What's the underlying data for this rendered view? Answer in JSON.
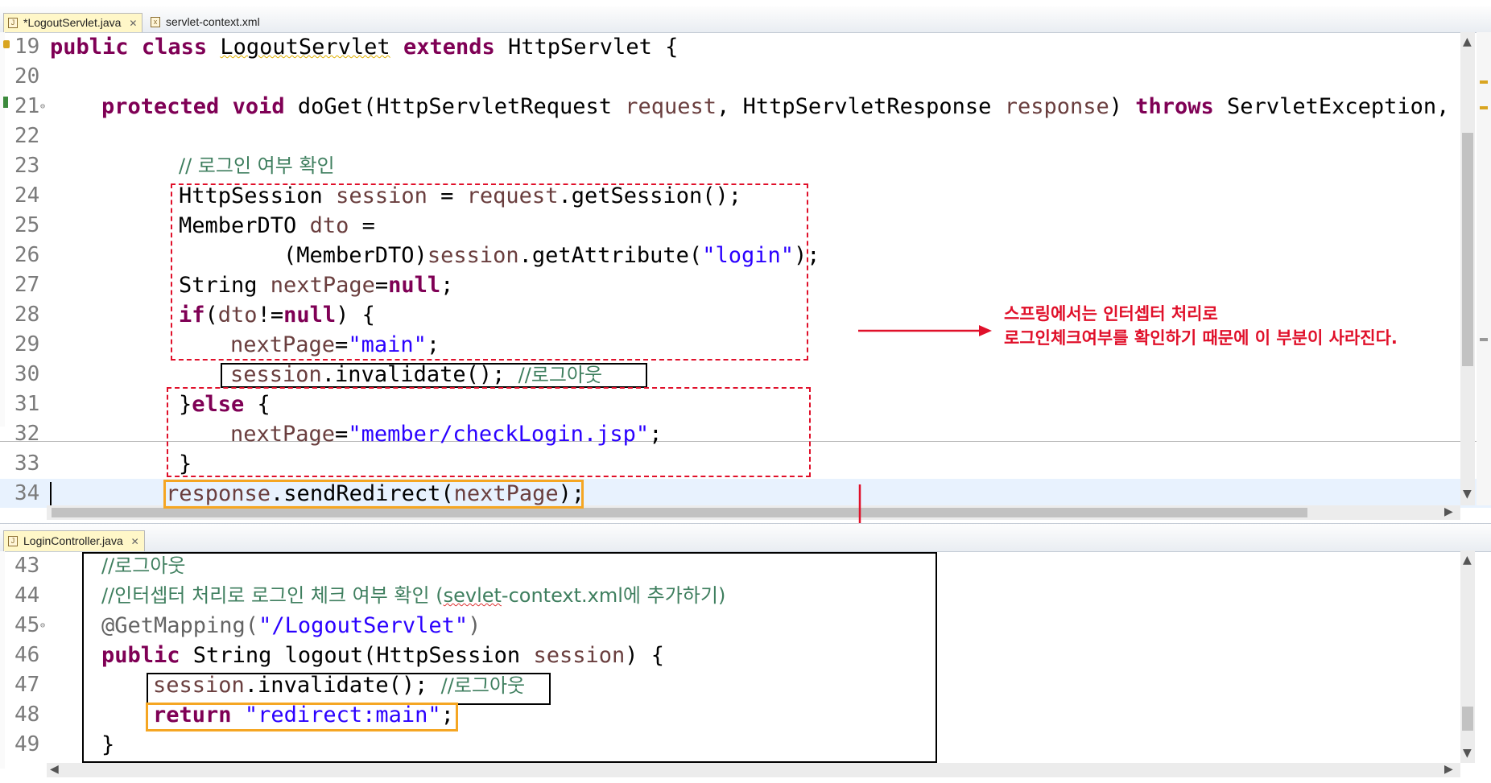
{
  "top_editor": {
    "tabs": [
      {
        "label": "*LogoutServlet.java",
        "close": "✕"
      },
      {
        "label": "servlet-context.xml"
      }
    ],
    "lines": {
      "l19": {
        "n": "19",
        "kw1": "public",
        "kw2": "class",
        "name": "LogoutServlet",
        "kw3": "extends",
        "rest": "HttpServlet {"
      },
      "l20": {
        "n": "20"
      },
      "l21": {
        "n": "21",
        "kw1": "protected",
        "kw2": "void",
        "t1": "doGet(HttpServletRequest ",
        "v1": "request",
        "t2": ", HttpServletResponse ",
        "v2": "response",
        "t3": ") ",
        "kw3": "throws",
        "t4": " ServletException, IO"
      },
      "l22": {
        "n": "22"
      },
      "l23": {
        "n": "23",
        "comment": "// 로그인 여부 확인"
      },
      "l24": {
        "n": "24",
        "t1": "HttpSession ",
        "v1": "session",
        "t2": " = ",
        "v2": "request",
        "t3": ".getSession();"
      },
      "l25": {
        "n": "25",
        "t1": "MemberDTO ",
        "v1": "dto",
        "t2": " ="
      },
      "l26": {
        "n": "26",
        "t1": "(MemberDTO)",
        "v1": "session",
        "t2": ".getAttribute(",
        "s1": "\"login\"",
        "t3": ");"
      },
      "l27": {
        "n": "27",
        "t1": "String ",
        "v1": "nextPage",
        "t2": "=",
        "kw1": "null",
        "t3": ";"
      },
      "l28": {
        "n": "28",
        "kw1": "if",
        "t1": "(",
        "v1": "dto",
        "t2": "!=",
        "kw2": "null",
        "t3": ") {"
      },
      "l29": {
        "n": "29",
        "v1": "nextPage",
        "t1": "=",
        "s1": "\"main\"",
        "t2": ";"
      },
      "l30": {
        "n": "30",
        "v1": "session",
        "t1": ".invalidate(); ",
        "c1": "//로그아웃"
      },
      "l31": {
        "n": "31",
        "t1": "}",
        "kw1": "else",
        "t2": " {"
      },
      "l32": {
        "n": "32",
        "v1": "nextPage",
        "t1": "=",
        "s1": "\"member/checkLogin.jsp\"",
        "t2": ";"
      },
      "l33": {
        "n": "33",
        "t1": "}"
      },
      "l34": {
        "n": "34",
        "v1": "response",
        "t1": ".sendRedirect(",
        "v2": "nextPage",
        "t2": ");"
      }
    }
  },
  "bottom_editor": {
    "tabs": [
      {
        "label": "LoginController.java",
        "close": "✕"
      }
    ],
    "lines": {
      "l43": {
        "n": "43",
        "comment": "//로그아웃"
      },
      "l44": {
        "n": "44",
        "c1": "//인터셉터 처리로 로그인 체크 여부 확인 (",
        "c2": "sevlet",
        "c3": "-context.xml에 추가하기)"
      },
      "l45": {
        "n": "45",
        "a1": "@GetMapping(",
        "s1": "\"/LogoutServlet\"",
        "a2": ")"
      },
      "l46": {
        "n": "46",
        "kw1": "public",
        "t1": " String logout(HttpSession ",
        "v1": "session",
        "t2": ") {"
      },
      "l47": {
        "n": "47",
        "v1": "session",
        "t1": ".invalidate(); ",
        "c1": "//로그아웃"
      },
      "l48": {
        "n": "48",
        "kw1": "return",
        "t1": " ",
        "s1": "\"redirect:main\"",
        "t2": ";"
      },
      "l49": {
        "n": "49",
        "t1": "}"
      }
    }
  },
  "annotation": {
    "line1": "스프링에서는 인터셉터 처리로",
    "line2": "로그인체크여부를 확인하기 때문에 이 부분이 사라진다."
  },
  "colors": {
    "keyword": "#7f0055",
    "variable": "#6a3e3e",
    "string": "#2a00ff",
    "comment": "#3f7f5f",
    "annotation_note": "#e0102a",
    "highlight_box": "#f5a623"
  }
}
